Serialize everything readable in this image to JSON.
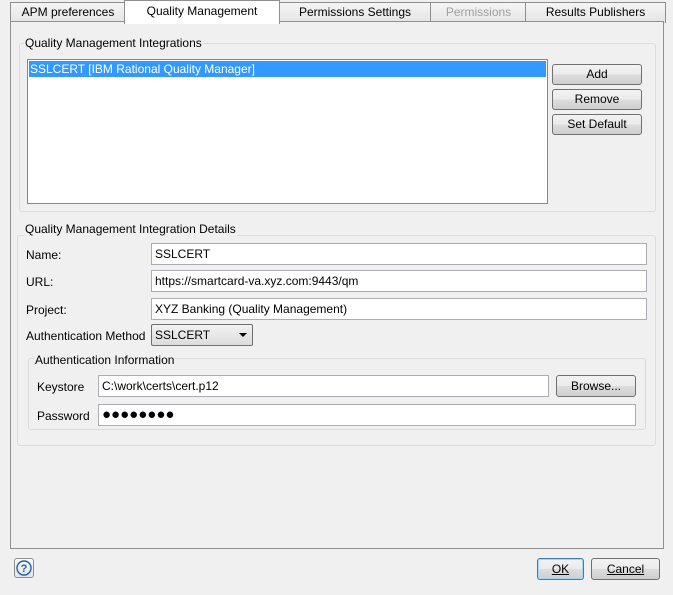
{
  "tabs": [
    {
      "label": "APM preferences",
      "active": false,
      "enabled": true
    },
    {
      "label": "Quality Management",
      "active": true,
      "enabled": true
    },
    {
      "label": "Permissions Settings",
      "active": false,
      "enabled": true
    },
    {
      "label": "Permissions",
      "active": false,
      "enabled": false
    },
    {
      "label": "Results Publishers",
      "active": false,
      "enabled": true
    }
  ],
  "integrations": {
    "title": "Quality Management Integrations",
    "items": [
      "SSLCERT [IBM Rational Quality Manager]"
    ],
    "selected_index": 0,
    "add_label": "Add",
    "remove_label": "Remove",
    "set_default_label": "Set Default"
  },
  "details": {
    "title": "Quality Management Integration Details",
    "name_label": "Name:",
    "name_value": "SSLCERT",
    "url_label": "URL:",
    "url_value": "https://smartcard-va.xyz.com:9443/qm",
    "project_label": "Project:",
    "project_value": "XYZ Banking (Quality Management)",
    "auth_method_label": "Authentication Method",
    "auth_method_value": "SSLCERT"
  },
  "auth_info": {
    "title": "Authentication Information",
    "keystore_label": "Keystore",
    "keystore_value": "C:\\work\\certs\\cert.p12",
    "browse_label": "Browse...",
    "password_label": "Password",
    "password_value": "●●●●●●●●"
  },
  "footer": {
    "help_icon": "help-icon",
    "ok_label": "OK",
    "cancel_label": "Cancel"
  },
  "colors": {
    "selection": "#3399ff",
    "background": "#f0f0f0"
  }
}
